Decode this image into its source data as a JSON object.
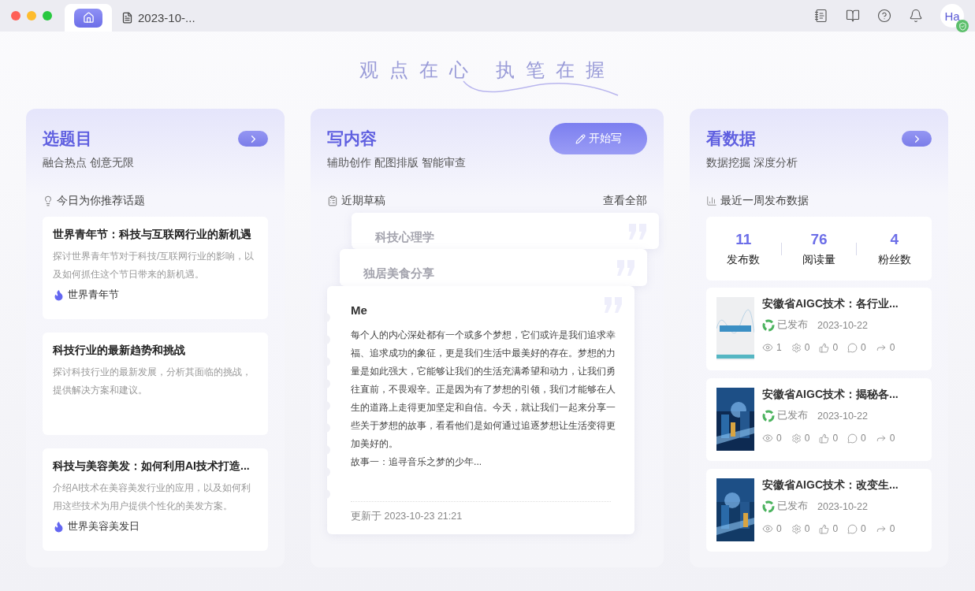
{
  "window": {
    "tabs": [
      {
        "kind": "home",
        "selected": true
      },
      {
        "kind": "document",
        "label": "2023-10-...",
        "selected": false
      }
    ],
    "avatar": {
      "initials": "Ha",
      "verified": true
    }
  },
  "slogan": "观点在心 执笔在握",
  "topics": {
    "title": "选题目",
    "subtitle": "融合热点 创意无限",
    "section_label": "今日为你推荐话题",
    "items": [
      {
        "title": "世界青年节：科技与互联网行业的新机遇",
        "description": "探讨世界青年节对于科技/互联网行业的影响，以及如何抓住这个节日带来的新机遇。",
        "tag": "世界青年节"
      },
      {
        "title": "科技行业的最新趋势和挑战",
        "description": "探讨科技行业的最新发展，分析其面临的挑战，提供解决方案和建议。"
      },
      {
        "title": "科技与美容美发：如何利用AI技术打造...",
        "description": "介绍AI技术在美容美发行业的应用，以及如何利用这些技术为用户提供个性化的美发方案。",
        "tag": "世界美容美发日"
      }
    ]
  },
  "writing": {
    "title": "写内容",
    "subtitle": "辅助创作 配图排版 智能审查",
    "button": "开始写",
    "section_label": "近期草稿",
    "view_all": "查看全部",
    "drafts": [
      {
        "title": "科技心理学"
      },
      {
        "title": "独居美食分享"
      },
      {
        "title": "Me",
        "body": [
          "每个人的内心深处都有一个或多个梦想，它们或许是我们追求幸福、追求成功的象征，更是我们生活中最美好的存在。梦想的力量是如此强大，它能够让我们的生活充满希望和动力，让我们勇往直前，不畏艰辛。正是因为有了梦想的引领，我们才能够在人生的道路上走得更加坚定和自信。今天，就让我们一起来分享一些关于梦想的故事，看看他们是如何通过追逐梦想让生活变得更加美好的。",
          "故事一：追寻音乐之梦的少年..."
        ],
        "updated": "更新于 2023-10-23 21:21"
      }
    ]
  },
  "data": {
    "title": "看数据",
    "subtitle": "数据挖掘 深度分析",
    "section_label": "最近一周发布数据",
    "stats": [
      {
        "value": "11",
        "label": "发布数"
      },
      {
        "value": "76",
        "label": "阅读量"
      },
      {
        "value": "4",
        "label": "粉丝数"
      }
    ],
    "articles": [
      {
        "title": "安徽省AIGC技术：各行业...",
        "status": "已发布",
        "date": "2023-10-22",
        "metrics": [
          "1",
          "0",
          "0",
          "0",
          "0"
        ]
      },
      {
        "title": "安徽省AIGC技术：揭秘各...",
        "status": "已发布",
        "date": "2023-10-22",
        "metrics": [
          "0",
          "0",
          "0",
          "0",
          "0"
        ]
      },
      {
        "title": "安徽省AIGC技术：改变生...",
        "status": "已发布",
        "date": "2023-10-22",
        "metrics": [
          "0",
          "0",
          "0",
          "0",
          "0"
        ]
      }
    ]
  }
}
